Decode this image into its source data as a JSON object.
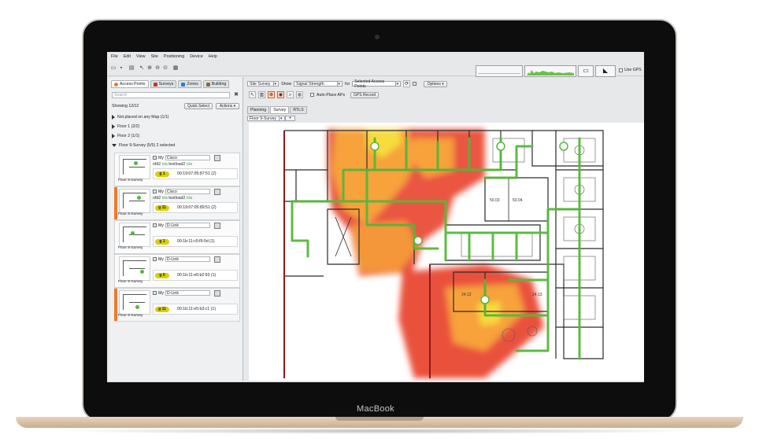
{
  "device": {
    "brand": "MacBook"
  },
  "menu": [
    "File",
    "Edit",
    "View",
    "Site",
    "Positioning",
    "Device",
    "Help"
  ],
  "toolbar": {
    "use_gps": "Use GPS"
  },
  "left_tabs": [
    {
      "label": "Access Points",
      "color": "#f07a2a"
    },
    {
      "label": "Surveys",
      "color": "#c0392b"
    },
    {
      "label": "Zones",
      "color": "#2e7dd1"
    },
    {
      "label": "Building",
      "color": "#8a6a3a"
    }
  ],
  "search_placeholder": "Search",
  "showing": "Showing 12/12",
  "buttons": {
    "quick_select": "Quick Select",
    "actions": "Actions ▾"
  },
  "tree": [
    {
      "label": "Not placed on any Map (1/1)",
      "open": false
    },
    {
      "label": "Floor 1 (2/2)",
      "open": false
    },
    {
      "label": "Floor 2 (1/1)",
      "open": false
    },
    {
      "label": "Floor 9-Survey (5/5) 2 selected",
      "open": true
    }
  ],
  "access_points": [
    {
      "owner": "My",
      "vendor": "Cisco",
      "ssid": "ofd2",
      "ssid2": "testload2",
      "na": "n/a",
      "channel": "g 1",
      "mac": "00:19:07:05:87:51 (2)",
      "floor": "Floor 9-Survey",
      "selected": false
    },
    {
      "owner": "My",
      "vendor": "Cisco",
      "ssid": "ofd2",
      "ssid2": "testload2",
      "na": "n/a",
      "channel": "g 11",
      "mac": "00:19:07:05:89:51 (2)",
      "floor": "Floor 9-Survey",
      "selected": true
    },
    {
      "owner": "My",
      "vendor": "D-Link",
      "ssid": "",
      "ssid2": "",
      "na": "",
      "channel": "g 1",
      "mac": "00:1b:11:c5:f9:0d (1)",
      "floor": "Floor 9-Survey",
      "selected": false
    },
    {
      "owner": "My",
      "vendor": "D-Link",
      "ssid": "",
      "ssid2": "",
      "na": "",
      "channel": "g 6",
      "mac": "00:1b:11:e5:b2:93 (1)",
      "floor": "Floor 9-Survey",
      "selected": false
    },
    {
      "owner": "My",
      "vendor": "D-Link",
      "ssid": "",
      "ssid2": "",
      "na": "",
      "channel": "g 11",
      "mac": "00:1b:11:e5:b3:c1 (1)",
      "floor": "Floor 9-Survey",
      "selected": true
    }
  ],
  "right_toolbar": {
    "mode": "Site Survey",
    "show_label": "Show",
    "show_value": "Signal Strength",
    "for_label": "for",
    "for_value": "Selected Access Points",
    "options": "Options ▾",
    "auto_place": "Auto-Place APs",
    "gps_record": "GPS Record"
  },
  "view_tabs": [
    "Planning",
    "Survey",
    "RTLS"
  ],
  "active_view_tab": "Survey",
  "floor_select": "Floor 9-Survey",
  "map": {
    "room_labels": [
      "50.03",
      "50.04",
      "24.12",
      "24.13"
    ],
    "colors": {
      "strong": "#e8432e",
      "medium": "#f7a23a",
      "weak": "#f7dc3e",
      "survey_path": "#56b83a"
    }
  }
}
